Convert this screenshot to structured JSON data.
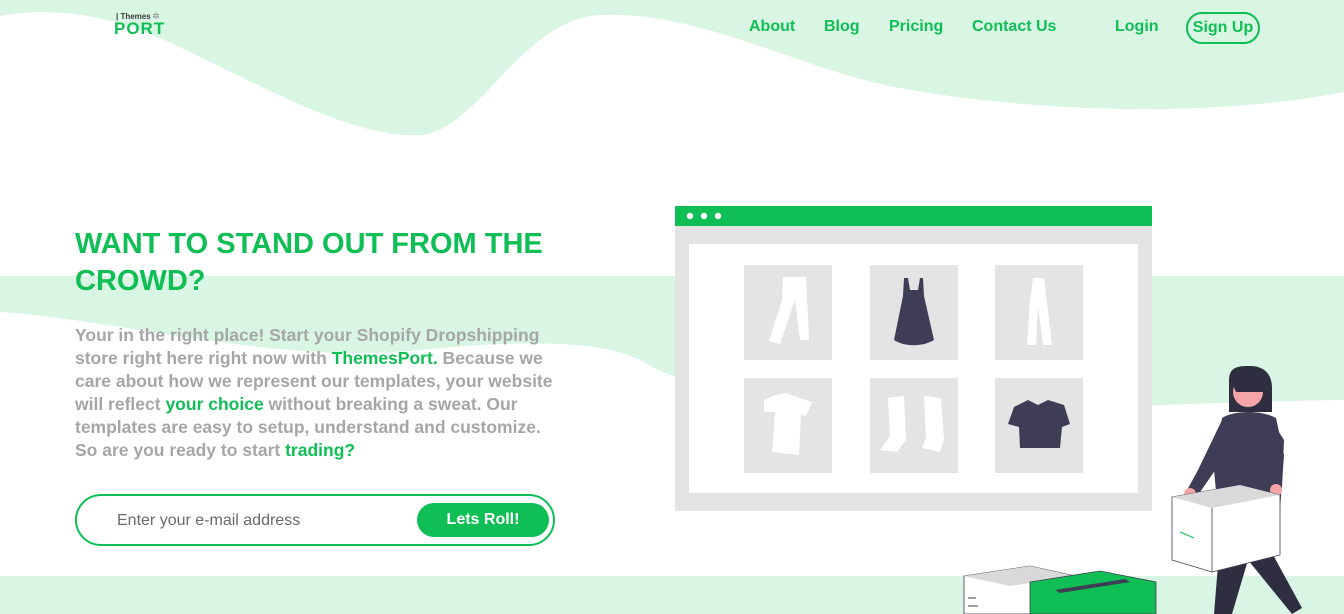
{
  "colors": {
    "brand": "#0fbf55",
    "wave": "#d9f5e3",
    "text_muted": "#a6a6a6",
    "figure_dark": "#3f3d56"
  },
  "logo": {
    "top": "| Themes",
    "main": "PORT"
  },
  "nav": {
    "about": "About",
    "blog": "Blog",
    "pricing": "Pricing",
    "contact": "Contact Us",
    "login": "Login",
    "signup": "Sign Up"
  },
  "hero": {
    "title": "WANT TO STAND OUT FROM THE CROWD?",
    "p1": "Your in the right place! Start your Shopify Dropshipping store right here right now with ",
    "hl1": "ThemesPort.",
    "p2": " Because we care about how we represent our templates, your website will reflect ",
    "hl2": "your choice",
    "p3": " without breaking a sweat. Our templates are easy to setup, understand and customize. So are you ready to start ",
    "hl3": "trading?"
  },
  "form": {
    "placeholder": "Enter your e-mail address",
    "button": "Lets Roll!"
  },
  "illustration": {
    "icons": [
      "pants-icon",
      "dress-icon",
      "trousers-icon",
      "tshirt-icon",
      "boots-icon",
      "sweater-icon"
    ]
  }
}
